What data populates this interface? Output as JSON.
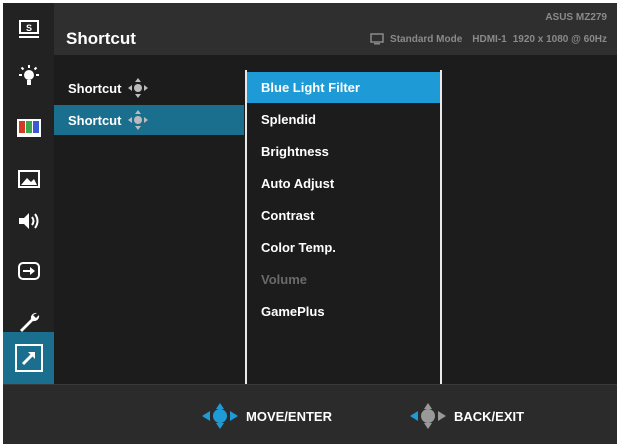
{
  "header": {
    "title": "Shortcut",
    "model": "ASUS MZ279",
    "mode": "Standard Mode",
    "input": "HDMI-1",
    "resolution": "1920 x 1080 @ 60Hz"
  },
  "sidebar": {
    "items": [
      {
        "name": "splendid-icon"
      },
      {
        "name": "blue-light-filter-icon"
      },
      {
        "name": "color-icon"
      },
      {
        "name": "image-icon"
      },
      {
        "name": "sound-icon"
      },
      {
        "name": "input-select-icon"
      },
      {
        "name": "system-setup-icon"
      },
      {
        "name": "shortcut-icon",
        "active": true
      }
    ]
  },
  "shortcut_list": [
    {
      "label": "Shortcut",
      "selected": false
    },
    {
      "label": "Shortcut",
      "selected": true
    }
  ],
  "options": [
    {
      "label": "Blue Light Filter",
      "selected": true
    },
    {
      "label": "Splendid"
    },
    {
      "label": "Brightness"
    },
    {
      "label": "Auto Adjust"
    },
    {
      "label": "Contrast"
    },
    {
      "label": "Color Temp."
    },
    {
      "label": "Volume",
      "disabled": true
    },
    {
      "label": "GamePlus"
    }
  ],
  "footer": {
    "move_label": "MOVE/ENTER",
    "back_label": "BACK/EXIT"
  },
  "colors": {
    "accent": "#1e9bd6",
    "selected_row": "#1a6e8e",
    "background": "#1c1c1c",
    "disabled_text": "#6a6a6a"
  }
}
